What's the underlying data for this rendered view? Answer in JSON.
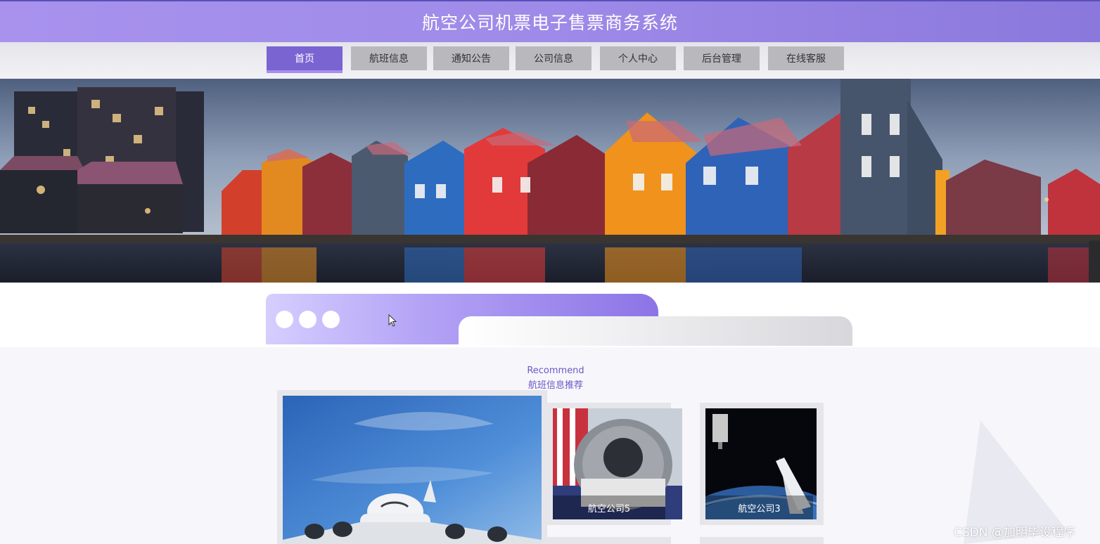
{
  "header": {
    "title": "航空公司机票电子售票商务系统"
  },
  "nav": {
    "items": [
      {
        "label": "首页",
        "active": true
      },
      {
        "label": "航班信息",
        "active": false
      },
      {
        "label": "通知公告",
        "active": false
      },
      {
        "label": "公司信息",
        "active": false
      },
      {
        "label": "个人中心",
        "active": false
      },
      {
        "label": "后台管理",
        "active": false
      },
      {
        "label": "在线客服",
        "active": false
      }
    ]
  },
  "recommend": {
    "title_en": "Recommend",
    "title_cn": "航班信息推荐",
    "cards": [
      {
        "caption": "航空公司5"
      },
      {
        "caption": "航空公司3"
      }
    ]
  },
  "watermark": "CSDN @加明毕设程序",
  "colors": {
    "header": "#9e8ae8",
    "nav_active": "#7a64d2",
    "nav_item": "#b9b9bd",
    "accent_text": "#6a58c8"
  }
}
